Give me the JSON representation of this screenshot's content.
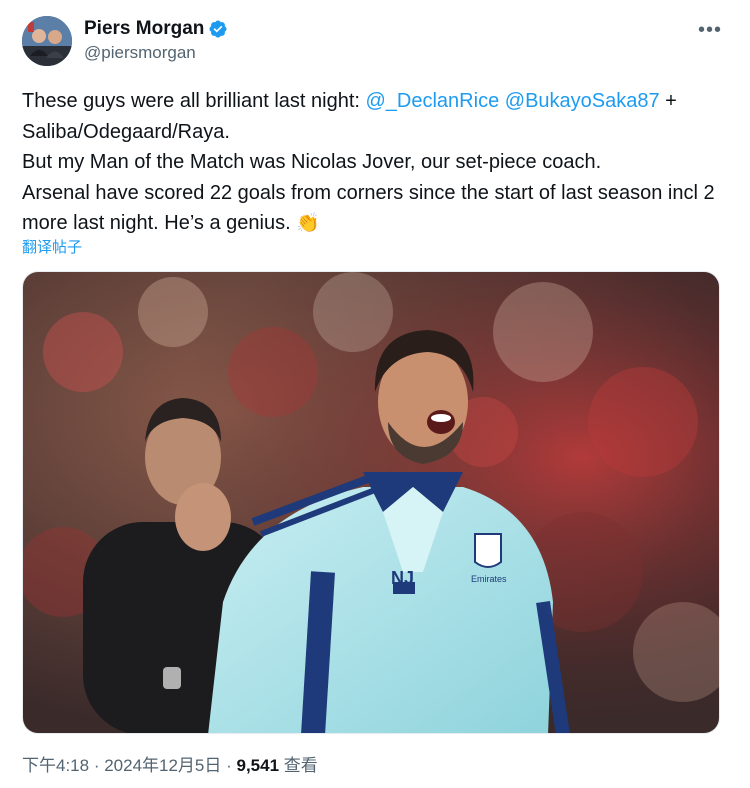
{
  "author": {
    "name": "Piers Morgan",
    "handle": "@piersmorgan",
    "verified": true,
    "avatar_icon": "avatar-photo"
  },
  "more_icon": "more-horizontal-icon",
  "tweet": {
    "text_part1": "These guys were all brilliant last night: ",
    "mention1": "@_DeclanRice",
    "mention2": "@BukayoSaka87",
    "text_part2": " + Saliba/Odegaard/Raya.",
    "line2": "But my Man of the Match was Nicolas Jover, our set-piece coach.",
    "line3": "Arsenal have scored 22 goals from corners since the start of last season incl 2 more last night. He’s a genius. ",
    "emoji": "👏"
  },
  "translate_label": "翻译帖子",
  "media": {
    "kind": "photo",
    "shirt_initials": "NJ",
    "shirt_sponsor": "Emirates\nFLY BETTER"
  },
  "meta": {
    "time": "下午4:18",
    "sep1": " · ",
    "date": "2024年12月5日",
    "sep2": " · ",
    "views": "9,541",
    "views_label": " 查看"
  },
  "colors": {
    "link": "#1d9bf0",
    "secondary": "#536471",
    "verified": "#1d9bf0"
  }
}
